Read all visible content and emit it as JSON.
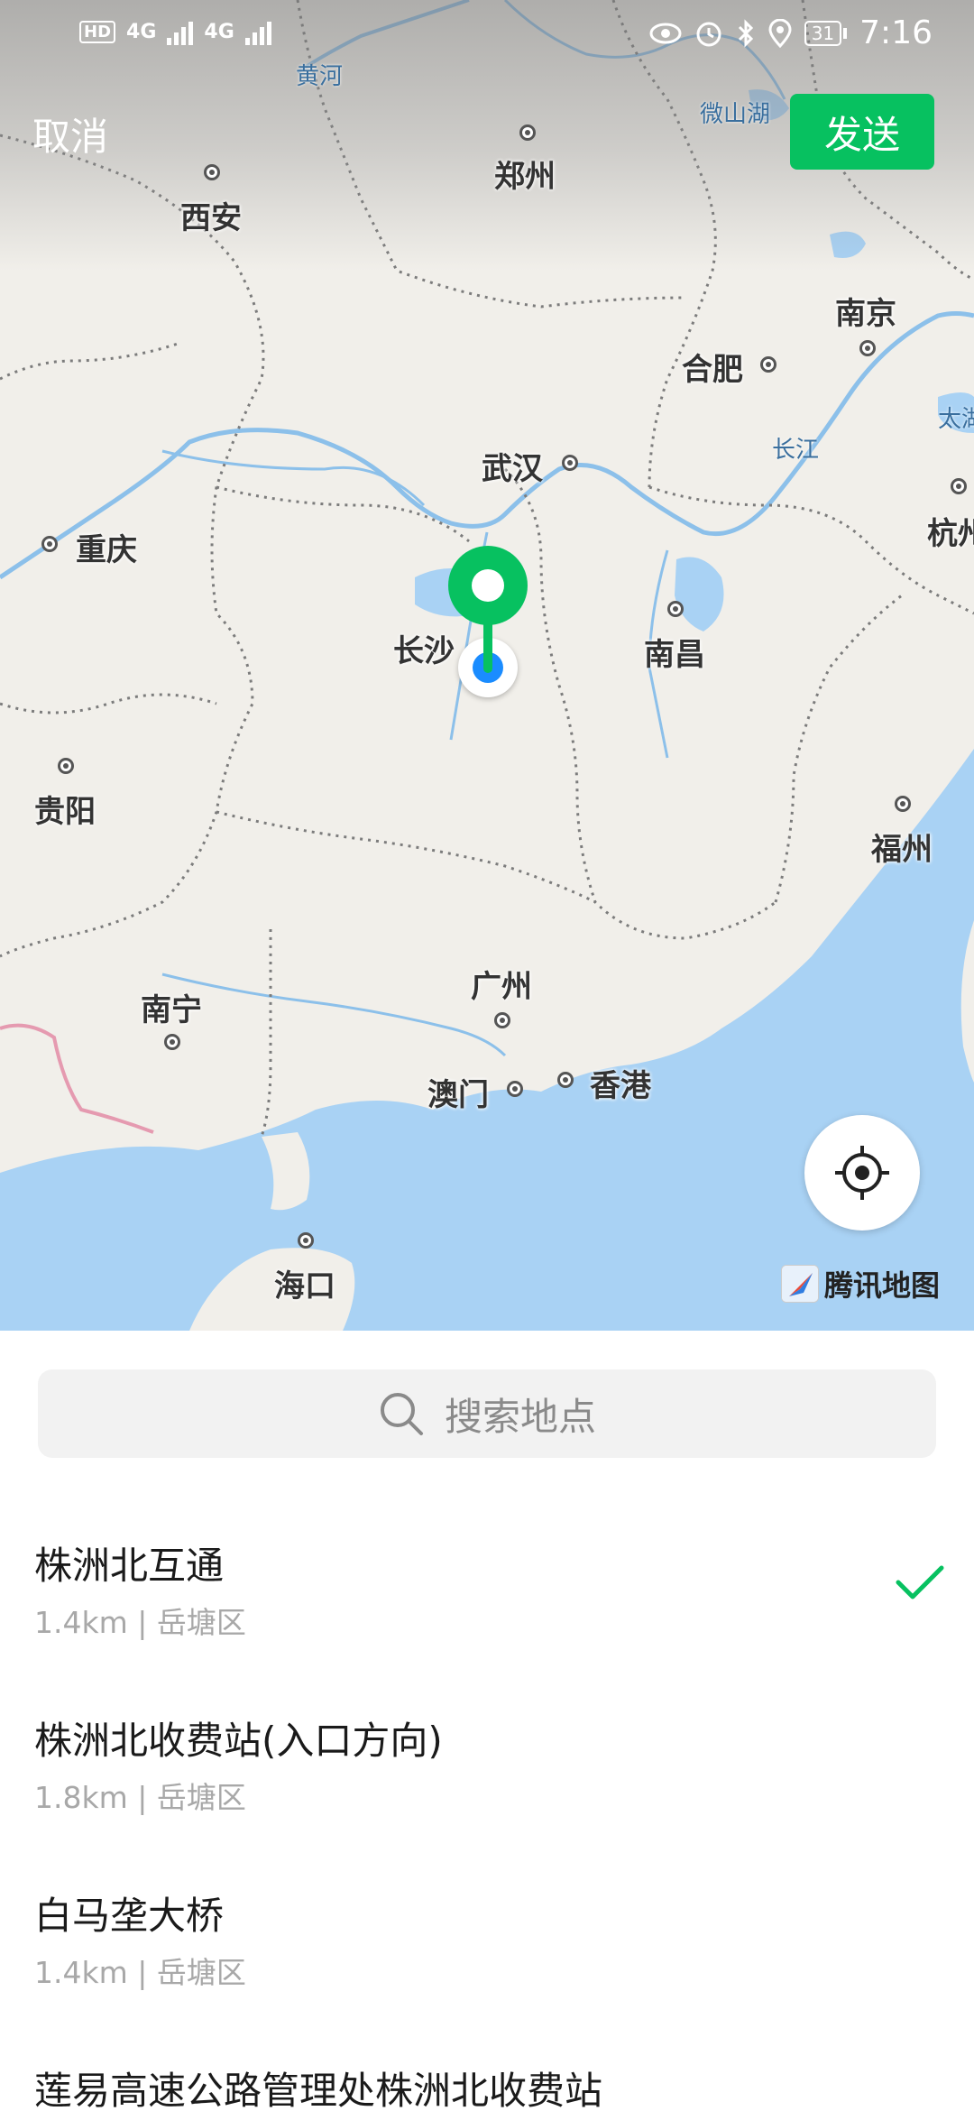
{
  "status_bar": {
    "left_badge": "HD",
    "net1": "4G",
    "net2": "4G",
    "battery": "31",
    "time": "7:16"
  },
  "header": {
    "cancel_label": "取消",
    "send_label": "发送"
  },
  "map": {
    "cities": [
      {
        "name": "郑州"
      },
      {
        "name": "西安"
      },
      {
        "name": "南京"
      },
      {
        "name": "合肥"
      },
      {
        "name": "武汉"
      },
      {
        "name": "杭州"
      },
      {
        "name": "重庆"
      },
      {
        "name": "长沙"
      },
      {
        "name": "南昌"
      },
      {
        "name": "贵阳"
      },
      {
        "name": "福州"
      },
      {
        "name": "广州"
      },
      {
        "name": "南宁"
      },
      {
        "name": "澳门"
      },
      {
        "name": "香港"
      },
      {
        "name": "海口"
      }
    ],
    "water_labels": [
      "黄河",
      "微山湖",
      "长江",
      "太湖"
    ],
    "attribution": "腾讯地图",
    "accent_color": "#07c160",
    "location_color": "#1a8cff"
  },
  "search": {
    "placeholder": "搜索地点"
  },
  "results": [
    {
      "name": "株洲北互通",
      "meta": "1.4km | 岳塘区",
      "selected": true
    },
    {
      "name": "株洲北收费站(入口方向)",
      "meta": "1.8km | 岳塘区",
      "selected": false
    },
    {
      "name": "白马垄大桥",
      "meta": "1.4km | 岳塘区",
      "selected": false
    },
    {
      "name": "莲易高速公路管理处株洲北收费站",
      "meta": "",
      "selected": false
    }
  ]
}
